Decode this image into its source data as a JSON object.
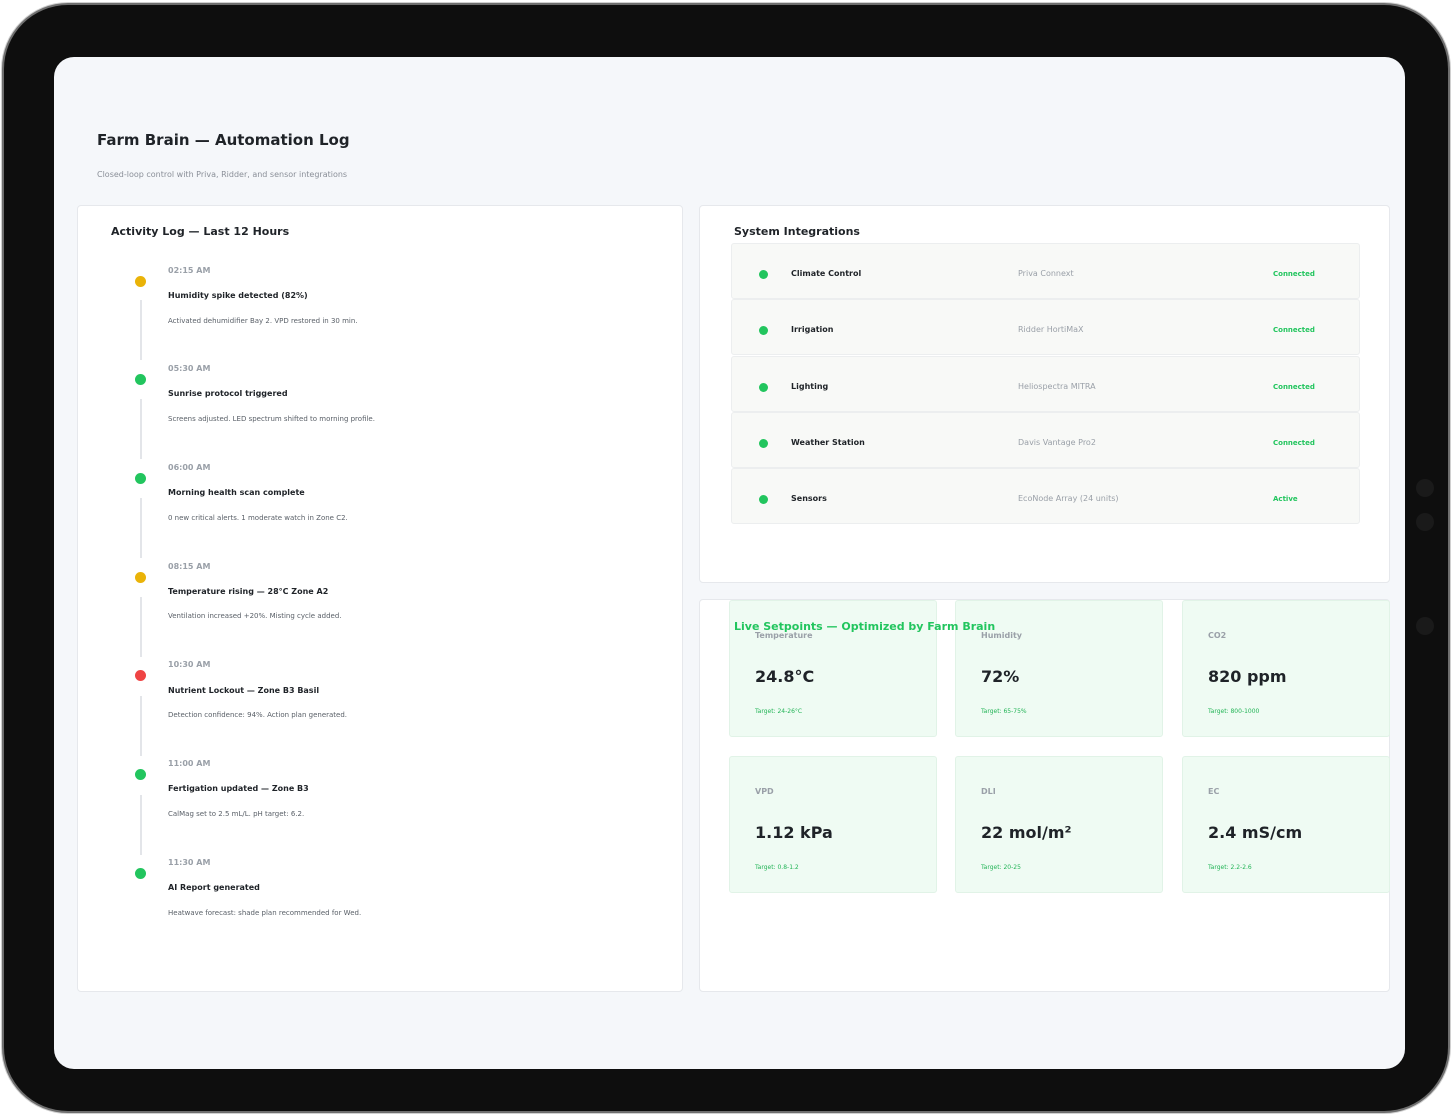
{
  "header": {
    "title": "Farm Brain — Automation Log",
    "subtitle": "Closed-loop control with Priva, Ridder, and sensor integrations"
  },
  "activity": {
    "title": "Activity Log — Last 12 Hours",
    "events": [
      {
        "time": "02:15 AM",
        "title": "Humidity spike detected (82%)",
        "desc": "Activated dehumidifier Bay 2. VPD restored in 30 min.",
        "status": "warning",
        "color": "#eab308"
      },
      {
        "time": "05:30 AM",
        "title": "Sunrise protocol triggered",
        "desc": "Screens adjusted. LED spectrum shifted to morning profile.",
        "status": "ok",
        "color": "#22c55e"
      },
      {
        "time": "06:00 AM",
        "title": "Morning health scan complete",
        "desc": "0 new critical alerts. 1 moderate watch in Zone C2.",
        "status": "ok",
        "color": "#22c55e"
      },
      {
        "time": "08:15 AM",
        "title": "Temperature rising — 28°C Zone A2",
        "desc": "Ventilation increased +20%. Misting cycle added.",
        "status": "warning",
        "color": "#eab308"
      },
      {
        "time": "10:30 AM",
        "title": "Nutrient Lockout — Zone B3 Basil",
        "desc": "Detection confidence: 94%. Action plan generated.",
        "status": "critical",
        "color": "#ef4444"
      },
      {
        "time": "11:00 AM",
        "title": "Fertigation updated — Zone B3",
        "desc": "CalMag set to 2.5 mL/L. pH target: 6.2.",
        "status": "ok",
        "color": "#22c55e"
      },
      {
        "time": "11:30 AM",
        "title": "AI Report generated",
        "desc": "Heatwave forecast: shade plan recommended for Wed.",
        "status": "ok",
        "color": "#22c55e"
      }
    ]
  },
  "integrations": {
    "title": "System Integrations",
    "items": [
      {
        "name": "Climate Control",
        "vendor": "Priva Connext",
        "status": "Connected",
        "color": "#22c55e"
      },
      {
        "name": "Irrigation",
        "vendor": "Ridder HortiMaX",
        "status": "Connected",
        "color": "#22c55e"
      },
      {
        "name": "Lighting",
        "vendor": "Heliospectra MITRA",
        "status": "Connected",
        "color": "#22c55e"
      },
      {
        "name": "Weather Station",
        "vendor": "Davis Vantage Pro2",
        "status": "Connected",
        "color": "#22c55e"
      },
      {
        "name": "Sensors",
        "vendor": "EcoNode Array (24 units)",
        "status": "Active",
        "color": "#22c55e"
      }
    ]
  },
  "setpoints": {
    "title": "Live Setpoints — Optimized by Farm Brain",
    "items": [
      {
        "label": "Temperature",
        "value": "24.8°C",
        "target": "Target: 24-26°C"
      },
      {
        "label": "Humidity",
        "value": "72%",
        "target": "Target: 65-75%"
      },
      {
        "label": "CO2",
        "value": "820 ppm",
        "target": "Target: 800-1000"
      },
      {
        "label": "VPD",
        "value": "1.12 kPa",
        "target": "Target: 0.8-1.2"
      },
      {
        "label": "DLI",
        "value": "22 mol/m²",
        "target": "Target: 20-25"
      },
      {
        "label": "EC",
        "value": "2.4 mS/cm",
        "target": "Target: 2.2-2.6"
      }
    ]
  },
  "colors": {
    "accent": "#22c55e",
    "warning": "#eab308",
    "critical": "#ef4444"
  }
}
